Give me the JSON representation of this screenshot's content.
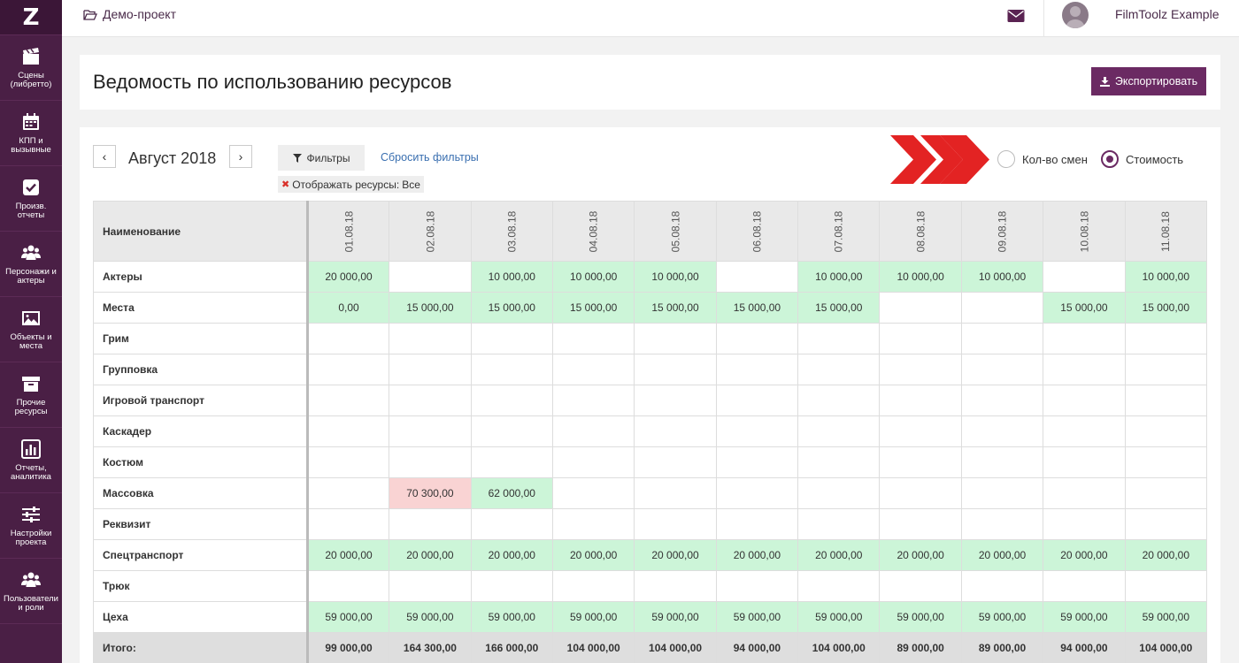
{
  "sidebar": {
    "logo": "Z",
    "items": [
      {
        "label": "Сцены (либретто)",
        "icon": "clapperboard-icon"
      },
      {
        "label": "КПП и вызывные",
        "icon": "calendar-icon"
      },
      {
        "label": "Произв. отчеты",
        "icon": "checkbox-icon"
      },
      {
        "label": "Персонажи и актеры",
        "icon": "users-icon"
      },
      {
        "label": "Объекты и места",
        "icon": "image-icon"
      },
      {
        "label": "Прочие ресурсы",
        "icon": "archive-box-icon"
      },
      {
        "label": "Отчеты, аналитика",
        "icon": "bar-chart-icon"
      },
      {
        "label": "Настройки проекта",
        "icon": "sliders-icon"
      },
      {
        "label": "Пользователи и роли",
        "icon": "users-group-icon"
      }
    ]
  },
  "topbar": {
    "project_name": "Демо-проект",
    "username": "FilmToolz Example"
  },
  "header": {
    "title": "Ведомость по использованию ресурсов",
    "export_label": "Экспортировать"
  },
  "toolbar": {
    "prev": "‹",
    "next": "›",
    "month": "Август 2018",
    "filters_label": "Фильтры",
    "reset_label": "Сбросить фильтры",
    "filter_tag": "Отображать ресурсы:",
    "filter_tag_value": "Все",
    "radio_shifts": "Кол-во смен",
    "radio_cost": "Стоимость",
    "selected": "cost"
  },
  "colors": {
    "accent": "#6b2a63",
    "sidebar": "#4a1f45",
    "positive": "#ccf5d8",
    "negative": "#f9d3d3",
    "arrow": "#e32323"
  },
  "table": {
    "name_header": "Наименование",
    "dates": [
      "01.08.18",
      "02.08.18",
      "03.08.18",
      "04.08.18",
      "05.08.18",
      "06.08.18",
      "07.08.18",
      "08.08.18",
      "09.08.18",
      "10.08.18",
      "11.08.18"
    ],
    "rows": [
      {
        "name": "Актеры",
        "cells": [
          {
            "v": "20 000,00",
            "s": "green"
          },
          {
            "v": "",
            "s": ""
          },
          {
            "v": "10 000,00",
            "s": "green"
          },
          {
            "v": "10 000,00",
            "s": "green"
          },
          {
            "v": "10 000,00",
            "s": "green"
          },
          {
            "v": "",
            "s": ""
          },
          {
            "v": "10 000,00",
            "s": "green"
          },
          {
            "v": "10 000,00",
            "s": "green"
          },
          {
            "v": "10 000,00",
            "s": "green"
          },
          {
            "v": "",
            "s": ""
          },
          {
            "v": "10 000,00",
            "s": "green"
          }
        ]
      },
      {
        "name": "Места",
        "cells": [
          {
            "v": "0,00",
            "s": "green"
          },
          {
            "v": "15 000,00",
            "s": "green"
          },
          {
            "v": "15 000,00",
            "s": "green"
          },
          {
            "v": "15 000,00",
            "s": "green"
          },
          {
            "v": "15 000,00",
            "s": "green"
          },
          {
            "v": "15 000,00",
            "s": "green"
          },
          {
            "v": "15 000,00",
            "s": "green"
          },
          {
            "v": "",
            "s": ""
          },
          {
            "v": "",
            "s": ""
          },
          {
            "v": "15 000,00",
            "s": "green"
          },
          {
            "v": "15 000,00",
            "s": "green"
          }
        ]
      },
      {
        "name": "Грим",
        "cells": []
      },
      {
        "name": "Групповка",
        "cells": []
      },
      {
        "name": "Игровой транспорт",
        "cells": []
      },
      {
        "name": "Каскадер",
        "cells": []
      },
      {
        "name": "Костюм",
        "cells": []
      },
      {
        "name": "Массовка",
        "cells": [
          {
            "v": "",
            "s": ""
          },
          {
            "v": "70 300,00",
            "s": "red"
          },
          {
            "v": "62 000,00",
            "s": "green"
          }
        ]
      },
      {
        "name": "Реквизит",
        "cells": []
      },
      {
        "name": "Спецтранспорт",
        "cells": [
          {
            "v": "20 000,00",
            "s": "green"
          },
          {
            "v": "20 000,00",
            "s": "green"
          },
          {
            "v": "20 000,00",
            "s": "green"
          },
          {
            "v": "20 000,00",
            "s": "green"
          },
          {
            "v": "20 000,00",
            "s": "green"
          },
          {
            "v": "20 000,00",
            "s": "green"
          },
          {
            "v": "20 000,00",
            "s": "green"
          },
          {
            "v": "20 000,00",
            "s": "green"
          },
          {
            "v": "20 000,00",
            "s": "green"
          },
          {
            "v": "20 000,00",
            "s": "green"
          },
          {
            "v": "20 000,00",
            "s": "green"
          }
        ]
      },
      {
        "name": "Трюк",
        "cells": []
      },
      {
        "name": "Цеха",
        "cells": [
          {
            "v": "59 000,00",
            "s": "green"
          },
          {
            "v": "59 000,00",
            "s": "green"
          },
          {
            "v": "59 000,00",
            "s": "green"
          },
          {
            "v": "59 000,00",
            "s": "green"
          },
          {
            "v": "59 000,00",
            "s": "green"
          },
          {
            "v": "59 000,00",
            "s": "green"
          },
          {
            "v": "59 000,00",
            "s": "green"
          },
          {
            "v": "59 000,00",
            "s": "green"
          },
          {
            "v": "59 000,00",
            "s": "green"
          },
          {
            "v": "59 000,00",
            "s": "green"
          },
          {
            "v": "59 000,00",
            "s": "green"
          }
        ]
      }
    ],
    "total": {
      "name": "Итого:",
      "cells": [
        "99 000,00",
        "164 300,00",
        "166 000,00",
        "104 000,00",
        "104 000,00",
        "94 000,00",
        "104 000,00",
        "89 000,00",
        "89 000,00",
        "94 000,00",
        "104 000,00"
      ]
    }
  }
}
